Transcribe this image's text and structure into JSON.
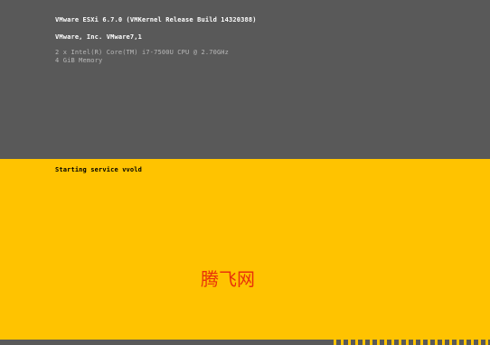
{
  "header": {
    "title": "VMware ESXi 6.7.0 (VMKernel Release Build 14320388)",
    "vendor": "VMware, Inc. VMware7,1",
    "cpu": "2 x Intel(R) Core(TM) i7-7500U CPU @ 2.70GHz",
    "memory": "4 GiB Memory"
  },
  "status": {
    "message": "Starting service vvold"
  },
  "watermark": {
    "text": "腾飞网"
  },
  "colors": {
    "header_background": "#595959",
    "status_background": "#ffc300",
    "watermark": "#e8320a"
  }
}
